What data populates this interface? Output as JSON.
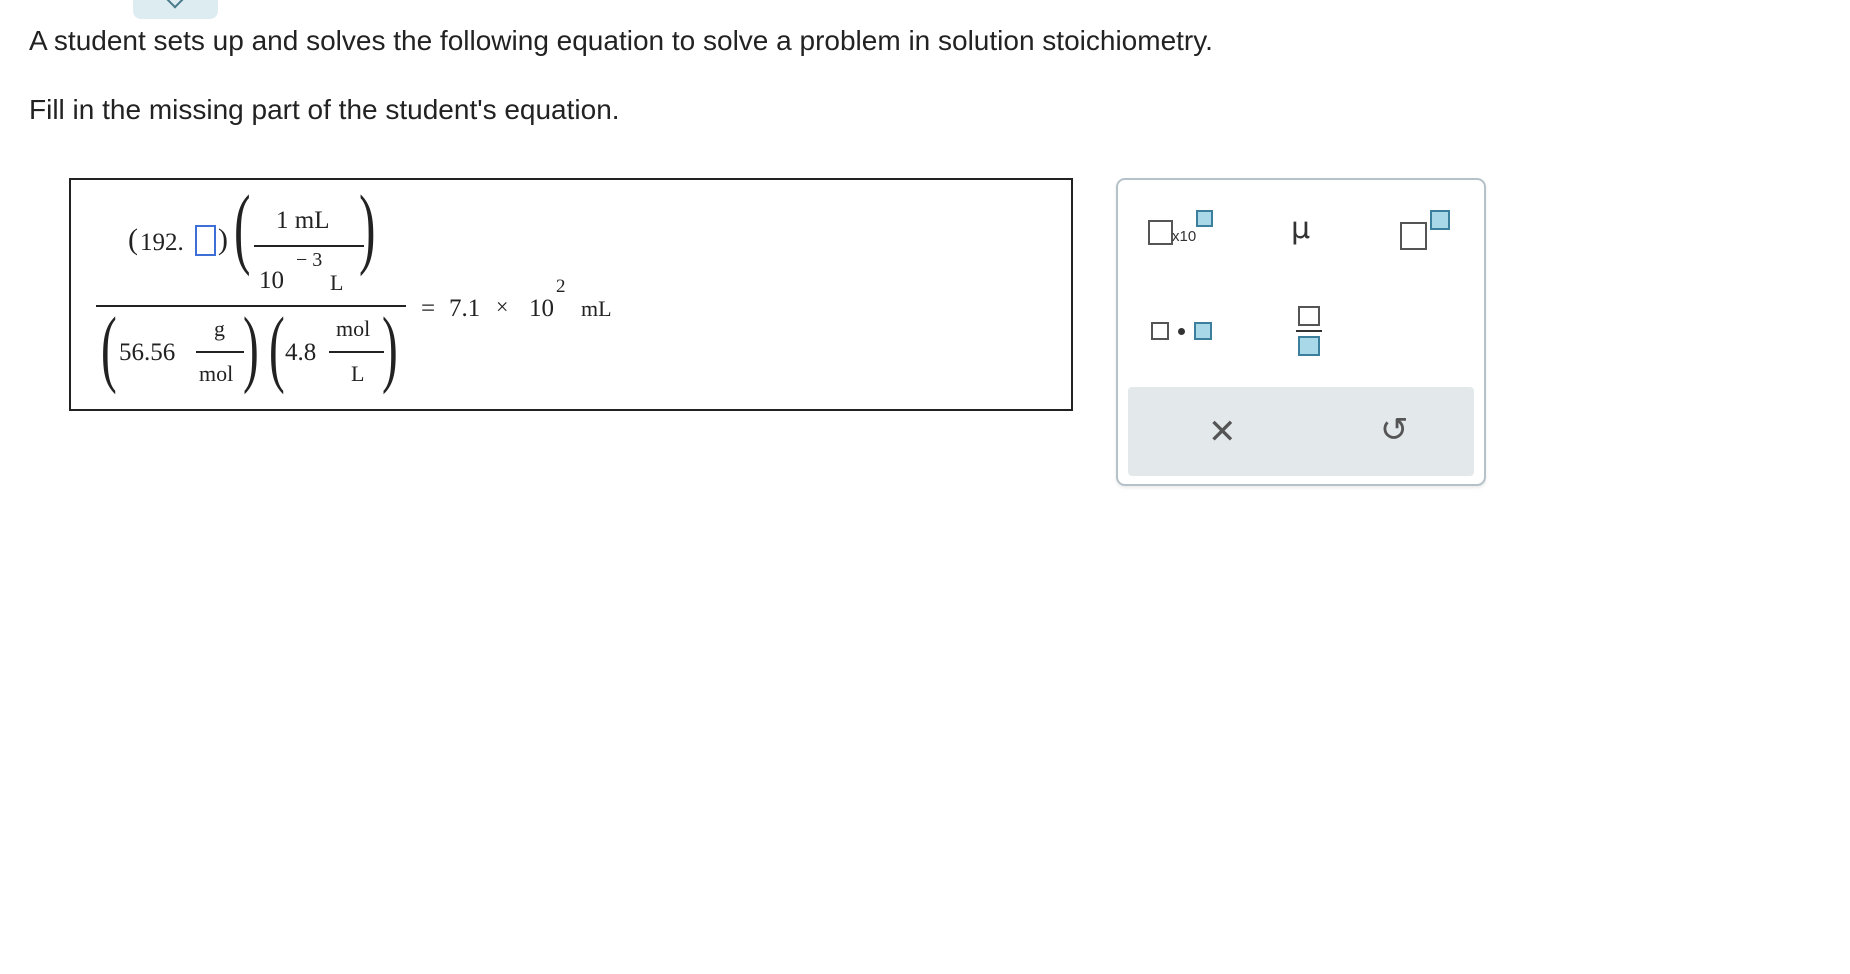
{
  "question": {
    "line1": "A student sets up and solves the following equation to solve a problem in solution stoichiometry.",
    "line2": "Fill in the missing part of the student's equation."
  },
  "equation": {
    "numerator": {
      "term1_open": "(",
      "term1_value": "192.",
      "term1_close": ")",
      "conv_top": "1 mL",
      "conv_base": "10",
      "conv_exp": "− 3",
      "conv_unit": "L"
    },
    "denominator": {
      "molar_mass_value": "56.56",
      "molar_mass_top": "g",
      "molar_mass_bottom": "mol",
      "conc_value": "4.8",
      "conc_top": "mol",
      "conc_bottom": "L"
    },
    "result": {
      "equals": "=",
      "coefficient": "7.1",
      "times": "×",
      "base": "10",
      "exponent": "2",
      "unit": "mL"
    }
  },
  "palette": {
    "x10_label": "x10",
    "mu_label": "μ",
    "clear_icon": "✕",
    "undo_icon": "↺"
  },
  "colors": {
    "blank_border": "#3d6fd6",
    "palette_border": "#b4c1c9",
    "action_bar_bg": "#e3e8eb",
    "tab_bg": "#dcecf1"
  }
}
